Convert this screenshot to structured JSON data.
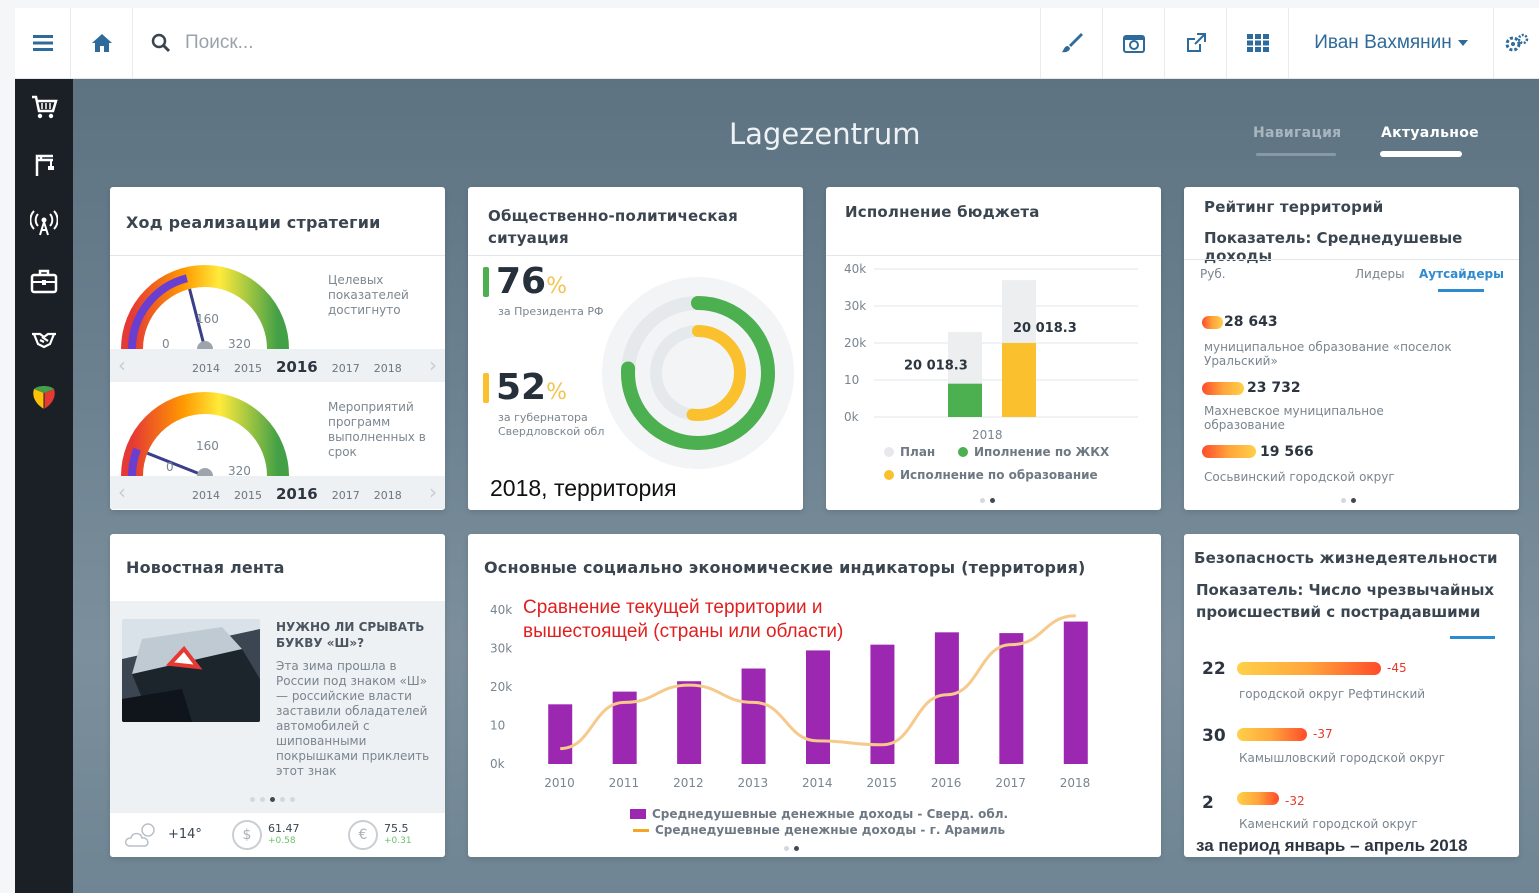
{
  "topbar": {
    "search_placeholder": "Поиск...",
    "user_name": "Иван Вахмянин",
    "icons": [
      "menu-icon",
      "home-icon",
      "search-icon",
      "brush-icon",
      "screenshot-icon",
      "external-link-icon",
      "grid-icon",
      "settings-icon"
    ]
  },
  "sidebar": {
    "icons": [
      "cart-icon",
      "crane-icon",
      "antenna-icon",
      "briefcase-icon",
      "handshake-icon",
      "emblem-icon"
    ]
  },
  "header": {
    "title": "Lagezentrum",
    "tabs": [
      {
        "label": "Навигация",
        "active": false
      },
      {
        "label": "Актуальное",
        "active": true
      }
    ]
  },
  "strategy": {
    "title": "Ход реализации стратегии",
    "gauges": [
      {
        "label": "Целевых показателей достигнуто",
        "ticks": [
          "0",
          "160",
          "320"
        ],
        "value_fraction": 0.42,
        "years": [
          "2014",
          "2015",
          "2016",
          "2017",
          "2018"
        ],
        "current_year": "2016"
      },
      {
        "label": "Мероприятий программ выполненных в срок",
        "ticks": [
          "0",
          "160",
          "320"
        ],
        "value_fraction": 0.12,
        "years": [
          "2014",
          "2015",
          "2016",
          "2017",
          "2018"
        ],
        "current_year": "2016"
      }
    ]
  },
  "political": {
    "title_line1": "Общественно-политическая",
    "title_line2": "ситуация",
    "items": [
      {
        "value": "76",
        "unit": "%",
        "caption": "за Президента РФ",
        "color": "#4caf50"
      },
      {
        "value": "52",
        "unit": "%",
        "caption": "за губернатора Свердловской обл",
        "color": "#fbc02d"
      }
    ],
    "footer": "2018, территория"
  },
  "budget": {
    "title": "Исполнение бюджета",
    "legend": [
      "План",
      "Иполнение по ЖКХ",
      "Исполнение по образование"
    ]
  },
  "rating": {
    "title": "Рейтинг территорий",
    "subtitle": "Показатель: Среднедушевые доходы",
    "unit": "Руб.",
    "tab_leaders": "Лидеры",
    "tab_outsiders": "Аутсайдеры",
    "items": [
      {
        "value": "28 643",
        "name": "муниципальное образование «поселок Уральский»",
        "bar_fraction": 0.07
      },
      {
        "value": "23 732",
        "name": "Махневское муниципальное образование",
        "bar_fraction": 0.14
      },
      {
        "value": "19 566",
        "name": "Сосьвинский городской округ",
        "bar_fraction": 0.18
      }
    ]
  },
  "news": {
    "title": "Новостная лента",
    "headline": "НУЖНО ЛИ СРЫВАТЬ БУКВУ «Ш»?",
    "text": "Эта зима прошла в России под знаком «Ш» — российские власти заставили обладателей автомобилей с шипованными покрышками приклеить этот знак",
    "temp": "+14°",
    "usd": "61.47",
    "usd_change": "+0.58",
    "eur": "75.5",
    "eur_change": "+0.31",
    "usd_sign": "$",
    "eur_sign": "€"
  },
  "indicators": {
    "title": "Основные социально экономические индикаторы  (территория)",
    "note_line1": "Сравнение текущей территории и",
    "note_line2": "вышестоящей (страны или области)",
    "legend": [
      "Среднедушевные денежные доходы - Сверд. обл.",
      "Среднедушевные денежные доходы - г. Арамиль"
    ]
  },
  "safety": {
    "title": "Безопасность жизнедеятельности",
    "subtitle": "Показатель: Число чрезвычайных происшествий с пострадавшими",
    "items": [
      {
        "count": "22",
        "delta": "-45",
        "name": "городской округ Рефтинский",
        "bar_fraction": 0.9
      },
      {
        "count": "30",
        "delta": "-37",
        "name": "Камышловский городской округ",
        "bar_fraction": 0.44
      },
      {
        "count": "2",
        "delta": "-32",
        "name": "Каменский городской округ",
        "bar_fraction": 0.26
      }
    ],
    "period": "за период январь – апрель 2018"
  },
  "chart_data": [
    {
      "type": "bar",
      "title": "Исполнение бюджета",
      "categories": [
        "2018"
      ],
      "y_ticks": [
        "40k",
        "30k",
        "20k",
        "10",
        "0k"
      ],
      "ylim": [
        0,
        40000
      ],
      "series": [
        {
          "name": "План",
          "values": [
            22000
          ],
          "color": "#e6e8eb"
        },
        {
          "name": "Иполнение по ЖКХ",
          "values": [
            9000
          ],
          "color": "#4caf50",
          "label": "20 018.3"
        },
        {
          "name": "Исполнение по образование",
          "values": [
            20018.3
          ],
          "color": "#fbc02d",
          "label": "20 018.3"
        }
      ],
      "plan_values": [
        23000,
        37000
      ],
      "legend_position": "bottom"
    },
    {
      "type": "bar",
      "title": "Основные социально экономические индикаторы  (территория)",
      "categories": [
        "2010",
        "2011",
        "2012",
        "2013",
        "2014",
        "2015",
        "2016",
        "2017",
        "2018"
      ],
      "y_ticks": [
        "40k",
        "30k",
        "20k",
        "10",
        "0k"
      ],
      "ylim": [
        0,
        40000
      ],
      "series": [
        {
          "name": "Среднедушевные денежные доходы - Сверд. обл.",
          "type": "bar",
          "color": "#9c27b0",
          "values": [
            15500,
            18800,
            21500,
            24800,
            29500,
            31000,
            34200,
            34000,
            37000
          ]
        },
        {
          "name": "Среднедушевные денежные доходы - г. Арамиль",
          "type": "line",
          "color": "#f6c98c",
          "values": [
            4000,
            16000,
            20500,
            16000,
            6000,
            5000,
            18000,
            31000,
            38500
          ]
        }
      ],
      "legend_position": "bottom"
    }
  ]
}
